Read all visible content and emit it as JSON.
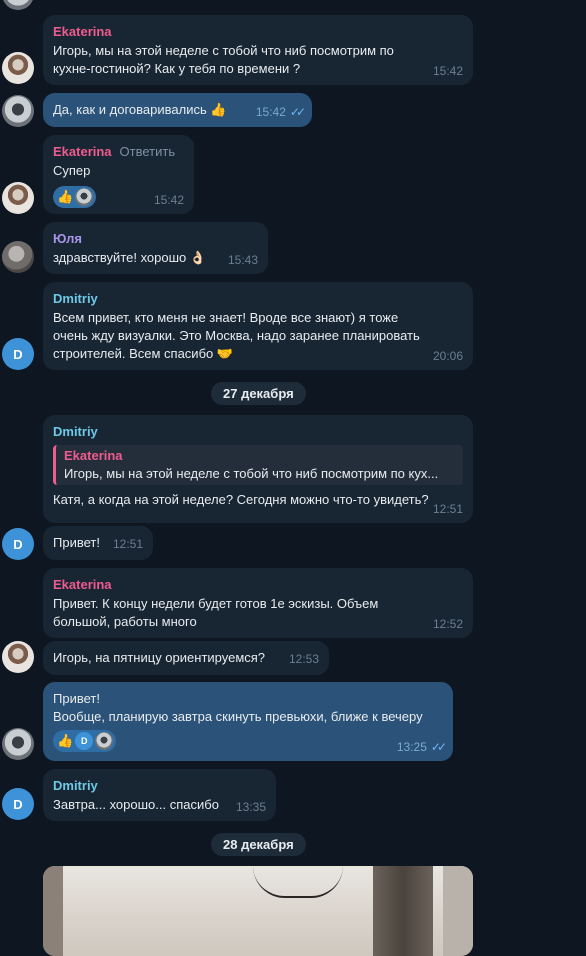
{
  "messages": [
    {
      "sender": "Ekaterina",
      "text": "Игорь, мы на этой неделе с тобой что ниб посмотрим по кухне-гостиной? Как у тебя по времени ?",
      "time": "15:42"
    },
    {
      "text": "Да, как и договаривались",
      "emoji": "👍",
      "time": "15:42"
    },
    {
      "sender": "Ekaterina",
      "reply_action": "Ответить",
      "text": "Супер",
      "time": "15:42"
    },
    {
      "sender": "Юля",
      "text": "здравствуйте! хорошо",
      "emoji": "👌🏻",
      "time": "15:43"
    },
    {
      "sender": "Dmitriy",
      "text": "Всем привет, кто меня не знает! Вроде все знают) я тоже очень жду визуалки. Это Москва, надо заранее планировать строителей. Всем спасибо",
      "emoji": "🤝",
      "time": "20:06"
    },
    {
      "sender": "Dmitriy",
      "quote_sender": "Ekaterina",
      "quote_text": "Игорь, мы на этой неделе с тобой что ниб посмотрим по кух...",
      "text": "Катя, а когда на этой неделе? Сегодня можно что-то увидеть?",
      "time": "12:51"
    },
    {
      "text": "Привет!",
      "time": "12:51"
    },
    {
      "sender": "Ekaterina",
      "text": "Привет. К концу недели будет готов 1е эскизы. Объем большой, работы много",
      "time": "12:52"
    },
    {
      "text": "Игорь, на пятницу ориентируемся?",
      "time": "12:53"
    },
    {
      "text": "Привет!\nВообще, планирую завтра скинуть превьюхи, ближе к вечеру",
      "time": "13:25"
    },
    {
      "sender": "Dmitriy",
      "text": "Завтра... хорошо... спасибо",
      "time": "13:35"
    }
  ],
  "dates": [
    "27 декабря",
    "28 декабря"
  ],
  "avatar_letter": "D",
  "reaction_emoji": "👍",
  "icons": {
    "read": "double-check-icon"
  }
}
